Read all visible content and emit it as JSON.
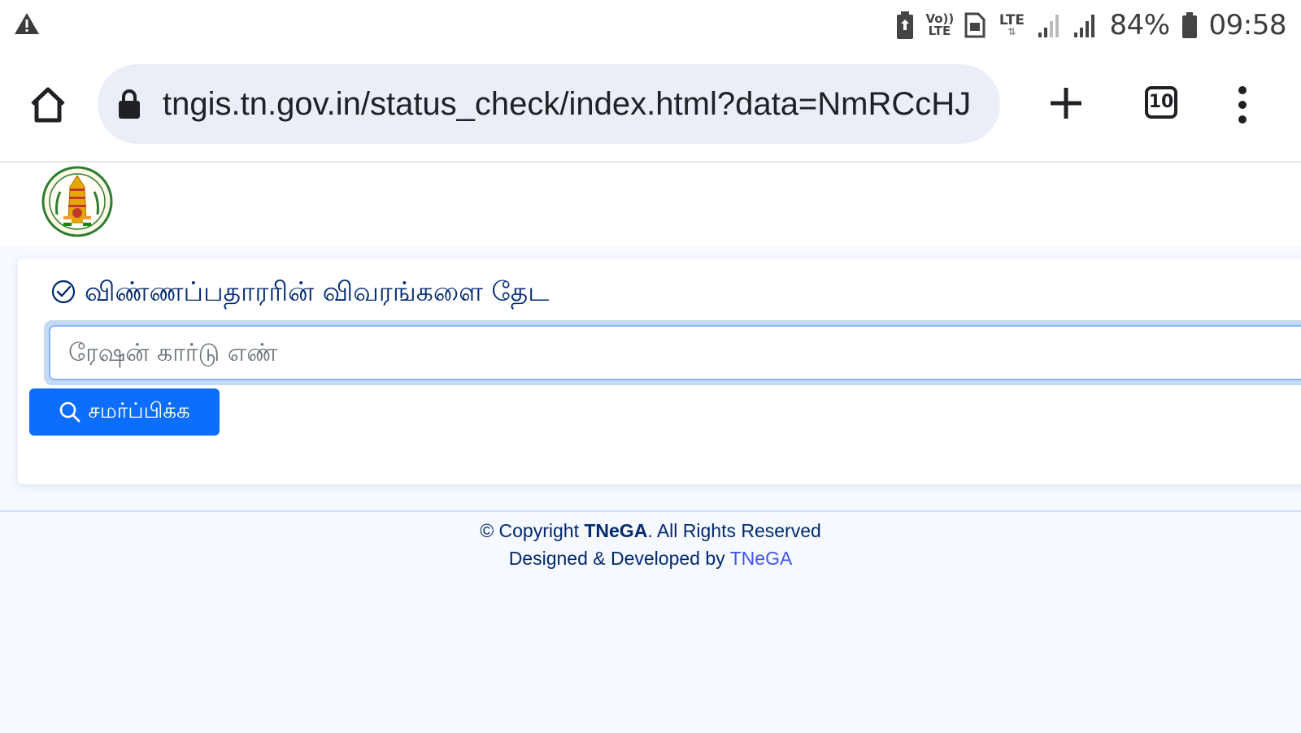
{
  "status_bar": {
    "warning_icon": "warning-triangle-icon",
    "volte_label": "Vo)) LTE",
    "lte_label": "LTE",
    "battery_percent": "84%",
    "time": "09:58"
  },
  "browser": {
    "url": "tngis.tn.gov.in/status_check/index.html?data=NmRCcHJ",
    "tab_count": "10",
    "icons": [
      "home-icon",
      "lock-icon",
      "plus-icon",
      "tabs-icon",
      "more-vert-icon"
    ]
  },
  "header": {
    "logo_icon": "tamil-nadu-emblem-icon"
  },
  "search_card": {
    "title": "விண்ணப்பதாரரின் விவரங்களை தேட",
    "input_placeholder": "ரேஷன் கார்டு எண்",
    "input_value": "",
    "submit_label": "சமர்ப்பிக்க"
  },
  "footer": {
    "copyright_prefix": "© Copyright ",
    "copyright_org": "TNeGA",
    "copyright_suffix": ". All Rights Reserved",
    "designed_prefix": "Designed & Developed by ",
    "designed_link": "TNeGA"
  },
  "colors": {
    "primary": "#0d6efd",
    "title": "#012970",
    "link": "#4154f1",
    "page_background": "#f6f9ff",
    "url_bar": "#e9eef7"
  }
}
